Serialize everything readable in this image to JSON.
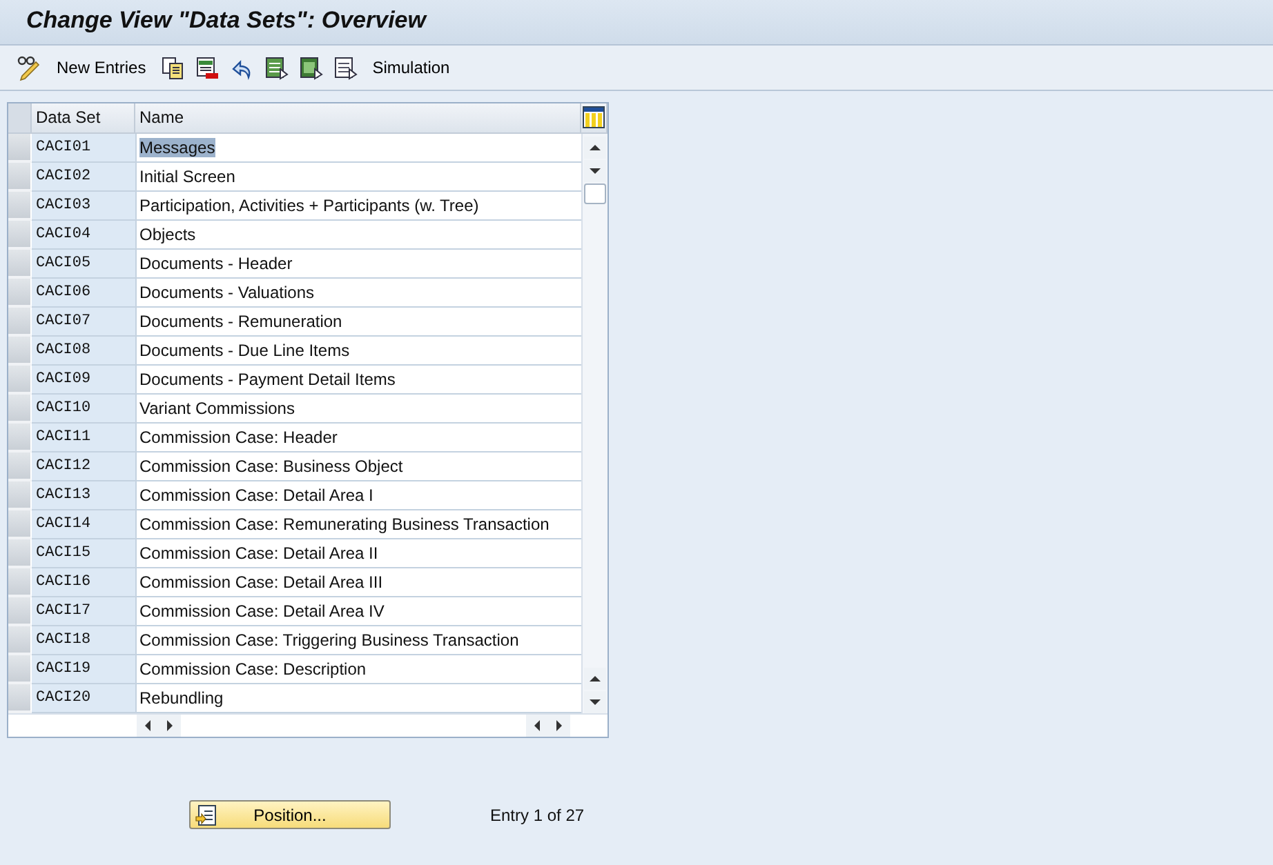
{
  "window": {
    "title": "Change View \"Data Sets\": Overview"
  },
  "toolbar": {
    "items": [
      {
        "kind": "icon"
      },
      {
        "kind": "text",
        "label": "New Entries"
      },
      {
        "kind": "icon"
      },
      {
        "kind": "icon"
      },
      {
        "kind": "icon"
      },
      {
        "kind": "icon"
      },
      {
        "kind": "icon"
      },
      {
        "kind": "icon"
      },
      {
        "kind": "text",
        "label": "Simulation"
      }
    ]
  },
  "table": {
    "columns": [
      "Data Set",
      "Name"
    ],
    "rows": [
      {
        "data_set": "CACI01",
        "name": "Messages",
        "selected": true
      },
      {
        "data_set": "CACI02",
        "name": "Initial Screen",
        "selected": false
      },
      {
        "data_set": "CACI03",
        "name": "Participation, Activities + Participants (w. Tree)",
        "selected": false
      },
      {
        "data_set": "CACI04",
        "name": "Objects",
        "selected": false
      },
      {
        "data_set": "CACI05",
        "name": "Documents - Header",
        "selected": false
      },
      {
        "data_set": "CACI06",
        "name": "Documents - Valuations",
        "selected": false
      },
      {
        "data_set": "CACI07",
        "name": "Documents - Remuneration",
        "selected": false
      },
      {
        "data_set": "CACI08",
        "name": "Documents - Due Line Items",
        "selected": false
      },
      {
        "data_set": "CACI09",
        "name": "Documents - Payment Detail Items",
        "selected": false
      },
      {
        "data_set": "CACI10",
        "name": "Variant Commissions",
        "selected": false
      },
      {
        "data_set": "CACI11",
        "name": "Commission Case: Header",
        "selected": false
      },
      {
        "data_set": "CACI12",
        "name": "Commission Case: Business Object",
        "selected": false
      },
      {
        "data_set": "CACI13",
        "name": "Commission Case: Detail Area I",
        "selected": false
      },
      {
        "data_set": "CACI14",
        "name": "Commission Case: Remunerating Business Transaction",
        "selected": false
      },
      {
        "data_set": "CACI15",
        "name": "Commission Case: Detail Area II",
        "selected": false
      },
      {
        "data_set": "CACI16",
        "name": "Commission Case: Detail Area III",
        "selected": false
      },
      {
        "data_set": "CACI17",
        "name": "Commission Case: Detail Area IV",
        "selected": false
      },
      {
        "data_set": "CACI18",
        "name": "Commission Case: Triggering Business Transaction",
        "selected": false
      },
      {
        "data_set": "CACI19",
        "name": "Commission Case: Description",
        "selected": false
      },
      {
        "data_set": "CACI20",
        "name": "Rebundling",
        "selected": false
      }
    ]
  },
  "footer": {
    "button": "Position...",
    "entry_info": "Entry 1 of 27"
  }
}
